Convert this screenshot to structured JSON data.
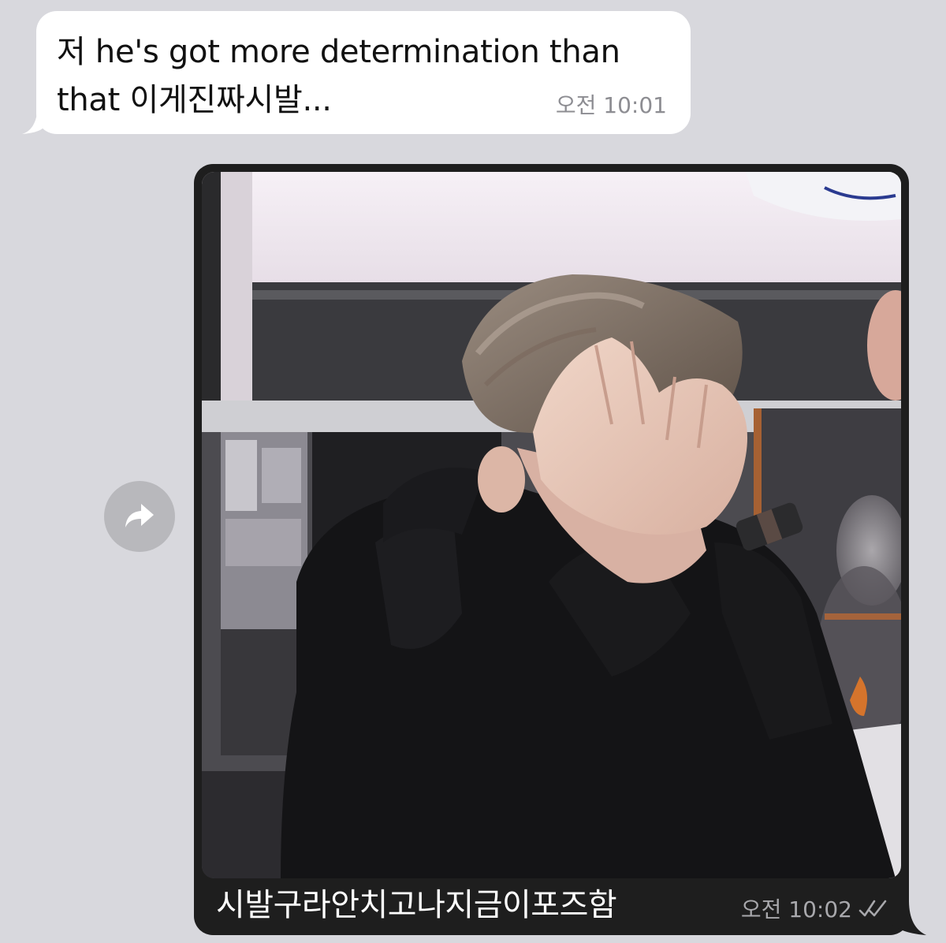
{
  "messages": [
    {
      "direction": "incoming",
      "text": "저 he's got more determination than that 이게진짜시발...",
      "time": "오전 10:01"
    },
    {
      "direction": "outgoing",
      "type": "photo",
      "caption": "시발구라안치고나지금이포즈함",
      "time": "오전 10:02",
      "status_icon": "double-check-icon"
    }
  ],
  "forward_button": {
    "icon": "forward-arrow-icon"
  },
  "colors": {
    "chat_background": "#d8d8dd",
    "incoming_bubble": "#ffffff",
    "outgoing_bubble": "#1e1e1e",
    "timestamp": "#8d8d92",
    "forward_button": "#b8b8bc"
  }
}
